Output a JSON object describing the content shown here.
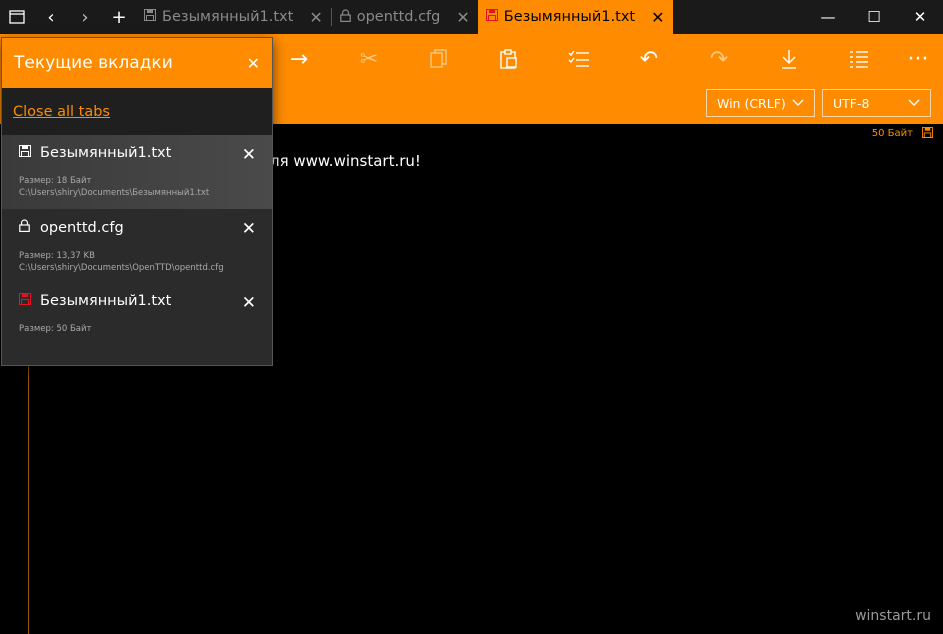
{
  "titlebar": {
    "tabs": [
      {
        "label": "Безымянный1.txt",
        "icon": "floppy-icon",
        "active": false
      },
      {
        "label": "openttd.cfg",
        "icon": "lock-icon",
        "active": false
      },
      {
        "label": "Безымянный1.txt",
        "icon": "floppy-icon-red",
        "active": true
      }
    ]
  },
  "toolbar": {
    "line_ending": "Win (CRLF)",
    "encoding": "UTF-8"
  },
  "editor": {
    "size_status": "50 Байт",
    "text": "ля www.winstart.ru!",
    "watermark": "winstart.ru"
  },
  "flyout": {
    "title": "Текущие вкладки",
    "close_all": "Close all tabs",
    "items": [
      {
        "name": "Безымянный1.txt",
        "size": "Размер: 18 Байт",
        "path": "C:\\Users\\shiry\\Documents\\Безымянный1.txt"
      },
      {
        "name": "openttd.cfg",
        "size": "Размер: 13,37 KB",
        "path": "C:\\Users\\shiry\\Documents\\OpenTTD\\openttd.cfg"
      },
      {
        "name": "Безымянный1.txt",
        "size": "Размер: 50 Байт",
        "path": ""
      }
    ]
  },
  "colors": {
    "accent": "#ff8c00",
    "unsaved": "#e81123"
  }
}
